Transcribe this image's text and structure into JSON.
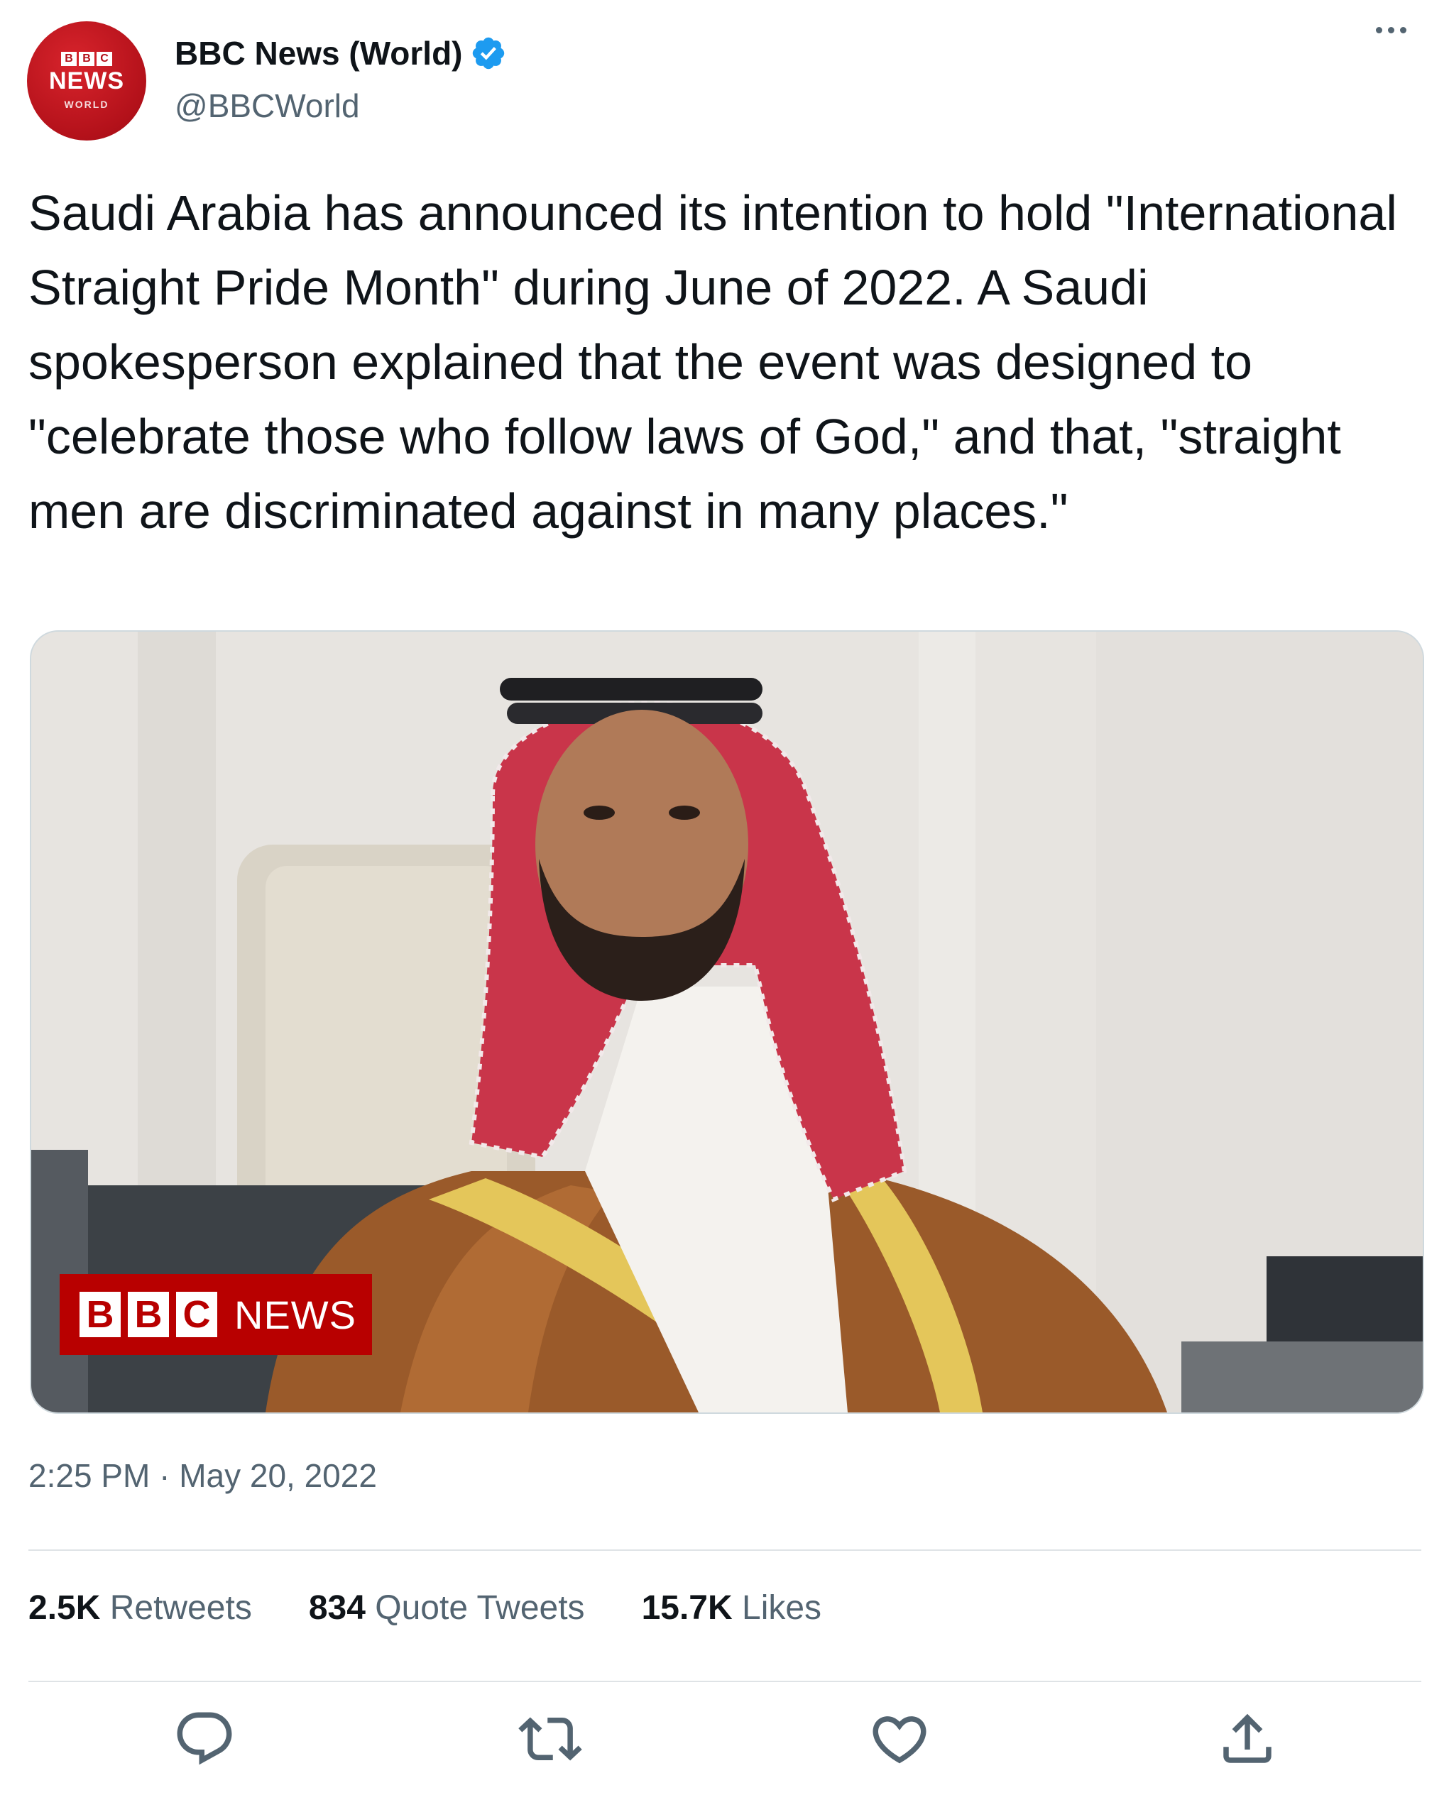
{
  "account": {
    "name": "BBC News (World)",
    "handle": "@BBCWorld",
    "avatar_letters": [
      "B",
      "B",
      "C"
    ],
    "avatar_news": "NEWS",
    "avatar_world": "WORLD"
  },
  "tweet": {
    "text": "Saudi Arabia has announced its intention to hold \"International Straight Pride Month\" during June of 2022. A Saudi spokesperson explained that the event was designed to \"celebrate those who follow laws of God,\" and that, \"straight men are discriminated against in many places.\"",
    "timestamp": "2:25 PM · May 20, 2022"
  },
  "media": {
    "badge_letters": [
      "B",
      "B",
      "C"
    ],
    "badge_news": "NEWS"
  },
  "stats": {
    "retweets": {
      "count": "2.5K",
      "label": "Retweets"
    },
    "quotes": {
      "count": "834",
      "label": "Quote Tweets"
    },
    "likes": {
      "count": "15.7K",
      "label": "Likes"
    }
  },
  "icons": {
    "verified": "verified-badge-icon",
    "more": "more-options-icon",
    "reply": "reply-icon",
    "retweet": "retweet-icon",
    "like": "heart-icon",
    "share": "share-icon"
  },
  "colors": {
    "bbc_red": "#b80000",
    "verified_blue": "#1d9bf0",
    "secondary_text": "#536471",
    "primary_text": "#0f1419"
  }
}
